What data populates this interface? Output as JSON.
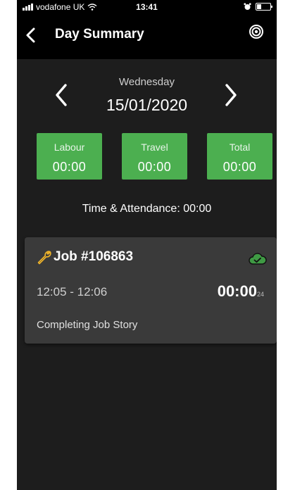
{
  "status_bar": {
    "carrier": "vodafone UK",
    "time": "13:41"
  },
  "header": {
    "title": "Day Summary"
  },
  "date_nav": {
    "day_name": "Wednesday",
    "date": "15/01/2020"
  },
  "summary": {
    "labour": {
      "label": "Labour",
      "value": "00:00"
    },
    "travel": {
      "label": "Travel",
      "value": "00:00"
    },
    "total": {
      "label": "Total",
      "value": "00:00"
    }
  },
  "time_attendance": "Time & Attendance: 00:00",
  "job": {
    "title": "Job #106863",
    "time_range": "12:05 - 12:06",
    "duration": "00:00",
    "duration_seconds": "24",
    "description": "Completing Job Story"
  },
  "colors": {
    "accent_green": "#4caf50",
    "background": "#1d1d1d",
    "card": "#3a3a3a",
    "wrench": "#f0b429"
  },
  "icons": [
    "back-arrow-icon",
    "target-icon",
    "chevron-left-icon",
    "chevron-right-icon",
    "wrench-icon",
    "cloud-check-icon",
    "signal-icon",
    "wifi-icon",
    "alarm-icon",
    "battery-icon"
  ]
}
